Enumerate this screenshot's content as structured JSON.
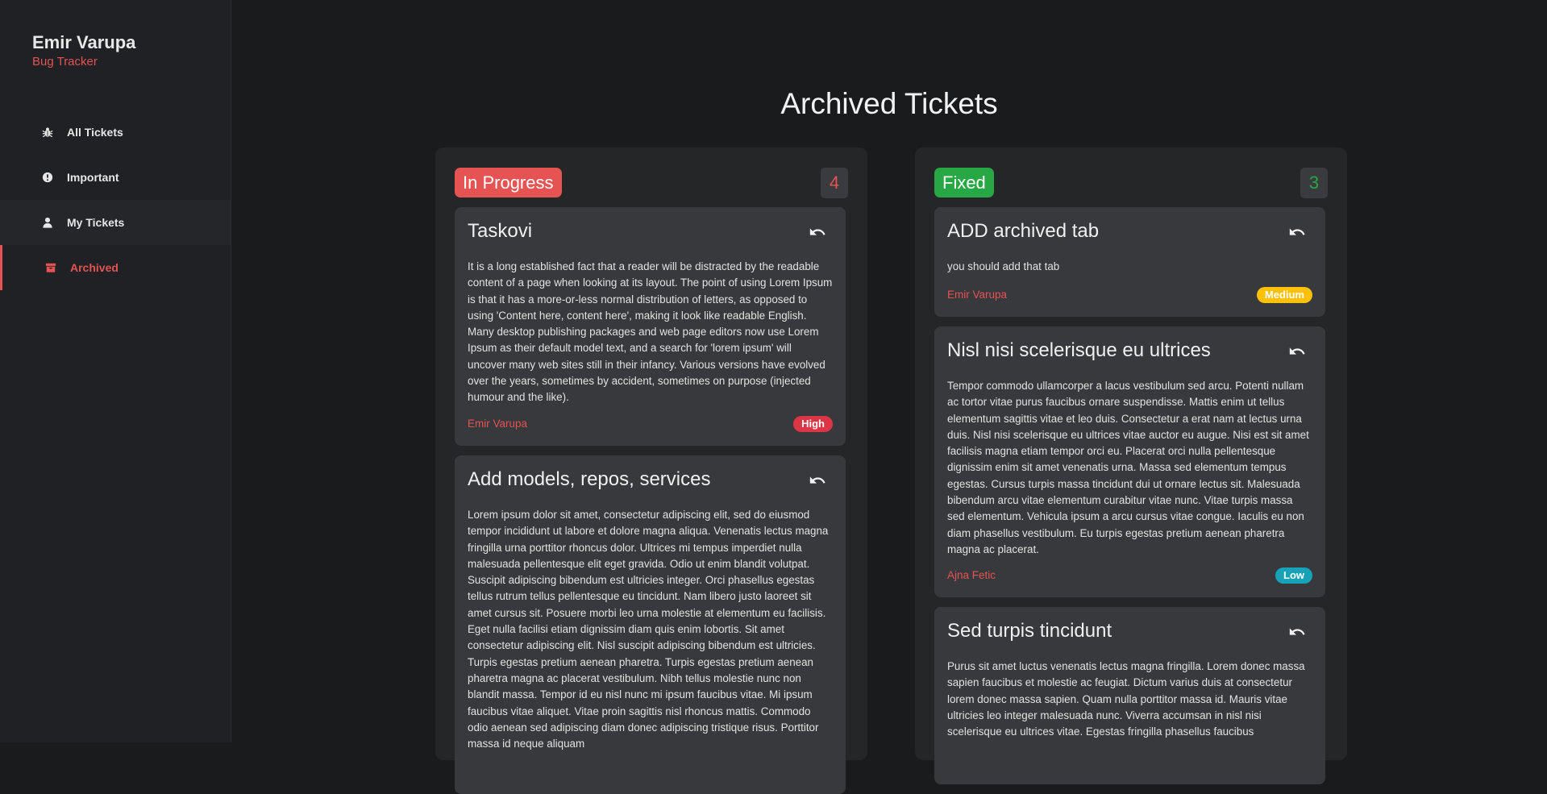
{
  "brand": {
    "name": "Emir Varupa",
    "subtitle": "Bug Tracker"
  },
  "nav": [
    {
      "label": "All Tickets",
      "icon": "bug-icon"
    },
    {
      "label": "Important",
      "icon": "exclamation-circle-icon"
    },
    {
      "label": "My Tickets",
      "icon": "user-icon"
    },
    {
      "label": "Archived",
      "icon": "archive-icon",
      "active": true
    }
  ],
  "page_title": "Archived Tickets",
  "colors": {
    "accent": "#e55353",
    "high": "#dc3545",
    "medium": "#ffc107",
    "low": "#17a2b8",
    "fixed": "#28a745"
  },
  "columns": [
    {
      "status": "In Progress",
      "count": "4",
      "tickets": [
        {
          "title": "Taskovi",
          "description": "It is a long established fact that a reader will be distracted by the readable content of a page when looking at its layout. The point of using Lorem Ipsum is that it has a more-or-less normal distribution of letters, as opposed to using 'Content here, content here', making it look like readable English. Many desktop publishing packages and web page editors now use Lorem Ipsum as their default model text, and a search for 'lorem ipsum' will uncover many web sites still in their infancy. Various versions have evolved over the years, sometimes by accident, sometimes on purpose (injected humour and the like).",
          "author": "Emir Varupa",
          "priority": "High"
        },
        {
          "title": "Add models, repos, services",
          "description": "Lorem ipsum dolor sit amet, consectetur adipiscing elit, sed do eiusmod tempor incididunt ut labore et dolore magna aliqua. Venenatis lectus magna fringilla urna porttitor rhoncus dolor. Ultrices mi tempus imperdiet nulla malesuada pellentesque elit eget gravida. Odio ut enim blandit volutpat. Suscipit adipiscing bibendum est ultricies integer. Orci phasellus egestas tellus rutrum tellus pellentesque eu tincidunt. Nam libero justo laoreet sit amet cursus sit. Posuere morbi leo urna molestie at elementum eu facilisis. Eget nulla facilisi etiam dignissim diam quis enim lobortis. Sit amet consectetur adipiscing elit. Nisl suscipit adipiscing bibendum est ultricies. Turpis egestas pretium aenean pharetra. Turpis egestas pretium aenean pharetra magna ac placerat vestibulum. Nibh tellus molestie nunc non blandit massa. Tempor id eu nisl nunc mi ipsum faucibus vitae. Mi ipsum faucibus vitae aliquet. Vitae proin sagittis nisl rhoncus mattis. Commodo odio aenean sed adipiscing diam donec adipiscing tristique risus. Porttitor massa id neque aliquam"
        }
      ]
    },
    {
      "status": "Fixed",
      "count": "3",
      "tickets": [
        {
          "title": "ADD archived tab",
          "description": "you should add that tab",
          "author": "Emir Varupa",
          "priority": "Medium"
        },
        {
          "title": "Nisl nisi scelerisque eu ultrices",
          "description": "Tempor commodo ullamcorper a lacus vestibulum sed arcu. Potenti nullam ac tortor vitae purus faucibus ornare suspendisse. Mattis enim ut tellus elementum sagittis vitae et leo duis. Consectetur a erat nam at lectus urna duis. Nisl nisi scelerisque eu ultrices vitae auctor eu augue. Nisi est sit amet facilisis magna etiam tempor orci eu. Placerat orci nulla pellentesque dignissim enim sit amet venenatis urna. Massa sed elementum tempus egestas. Cursus turpis massa tincidunt dui ut ornare lectus sit. Malesuada bibendum arcu vitae elementum curabitur vitae nunc. Vitae turpis massa sed elementum. Vehicula ipsum a arcu cursus vitae congue. Iaculis eu non diam phasellus vestibulum. Eu turpis egestas pretium aenean pharetra magna ac placerat.",
          "author": "Ajna Fetic",
          "priority": "Low"
        },
        {
          "title": "Sed turpis tincidunt",
          "description": "Purus sit amet luctus venenatis lectus magna fringilla. Lorem donec massa sapien faucibus et molestie ac feugiat. Dictum varius duis at consectetur lorem donec massa sapien. Quam nulla porttitor massa id. Mauris vitae ultricies leo integer malesuada nunc. Viverra accumsan in nisl nisi scelerisque eu ultrices vitae. Egestas fringilla phasellus faucibus"
        }
      ]
    }
  ]
}
